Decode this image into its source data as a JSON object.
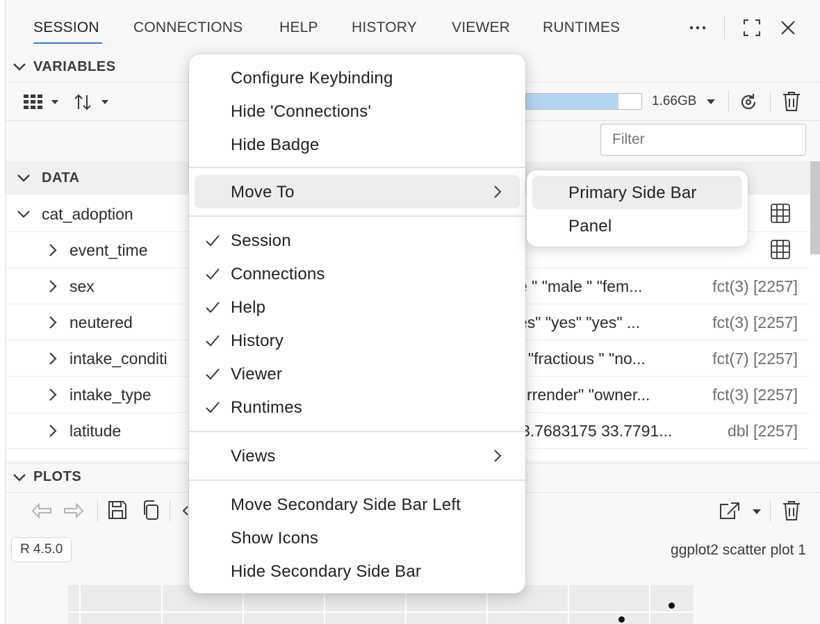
{
  "tabs": [
    {
      "label": "SESSION",
      "active": true
    },
    {
      "label": "CONNECTIONS"
    },
    {
      "label": "HELP"
    },
    {
      "label": "HISTORY"
    },
    {
      "label": "VIEWER"
    },
    {
      "label": "RUNTIMES"
    }
  ],
  "icons": {
    "more": "ellipsis-icon",
    "maximize": "maximize-icon",
    "close": "close-icon"
  },
  "variables": {
    "title": "VARIABLES",
    "memory": "1.66GB",
    "memory_fraction": 0.8,
    "filter_placeholder": "Filter"
  },
  "data": {
    "title": "DATA",
    "rows": [
      {
        "name": "cat_adoption",
        "value": "",
        "type": ""
      },
      {
        "name": "event_time",
        "value": "",
        "type": ""
      },
      {
        "name": "sex",
        "value": "e \" \"male \" \"fem...",
        "type": "fct(3) [2257]"
      },
      {
        "name": "neutered",
        "value": "es\" \"yes\" \"yes\" ...",
        "type": "fct(3) [2257]"
      },
      {
        "name": "intake_conditi",
        "value": "\"fractious \" \"no...",
        "type": "fct(7) [2257]"
      },
      {
        "name": "intake_type",
        "value": "rrender\" \"owner...",
        "type": "fct(3) [2257]"
      },
      {
        "name": "latitude",
        "value": "3.7683175 33.7791...",
        "type": "dbl [2257]"
      }
    ]
  },
  "plots": {
    "title": "PLOTS",
    "runtime_badge": "R 4.5.0",
    "plot_name": "ggplot2 scatter plot 1"
  },
  "context_menu": {
    "items_top": [
      "Configure Keybinding",
      "Hide 'Connections'",
      "Hide Badge"
    ],
    "move_to": "Move To",
    "checked_items": [
      "Session",
      "Connections",
      "Help",
      "History",
      "Viewer",
      "Runtimes"
    ],
    "views": "Views",
    "items_bottom": [
      "Move Secondary Side Bar Left",
      "Show Icons",
      "Hide Secondary Side Bar"
    ]
  },
  "submenu": {
    "items": [
      "Primary Side Bar",
      "Panel"
    ]
  },
  "colors": {
    "accent": "#3b7bd4",
    "memory_fill": "#b3d5f2"
  }
}
